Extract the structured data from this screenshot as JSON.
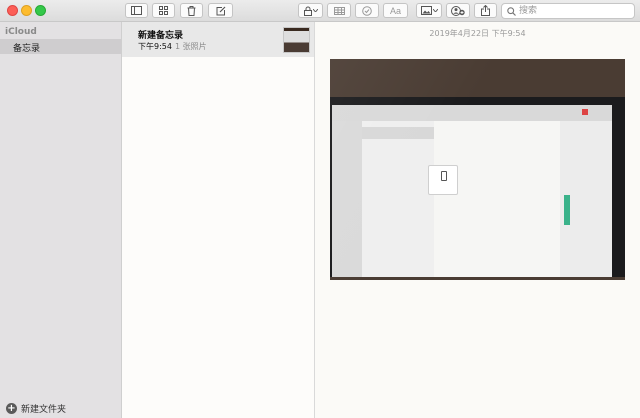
{
  "toolbar": {
    "buttons": [
      {
        "name": "sidebar-toggle",
        "icon": "sidebar-icon"
      },
      {
        "name": "gallery-view",
        "icon": "grid-icon"
      },
      {
        "name": "delete",
        "icon": "trash-icon"
      },
      {
        "name": "compose",
        "icon": "compose-icon"
      },
      {
        "name": "lock",
        "icon": "lock-icon"
      },
      {
        "name": "table",
        "icon": "table-icon"
      },
      {
        "name": "checklist",
        "icon": "checkmark-circle-icon"
      },
      {
        "name": "format",
        "icon": "format-icon"
      },
      {
        "name": "media",
        "icon": "photo-icon"
      },
      {
        "name": "collaborate",
        "icon": "add-people-icon"
      },
      {
        "name": "share",
        "icon": "share-icon"
      }
    ],
    "search": {
      "placeholder": "搜索",
      "value": ""
    },
    "format_label": "Aa"
  },
  "sidebar": {
    "account": "iCloud",
    "folders": [
      {
        "label": "备忘录",
        "selected": true
      }
    ],
    "new_folder_label": "新建文件夹"
  },
  "notelist": {
    "notes": [
      {
        "title": "新建备忘录",
        "time": "下午9:54",
        "attachments": "1 张照片",
        "selected": true
      }
    ]
  },
  "editor": {
    "date": "2019年4月22日 下午9:54"
  },
  "colors": {
    "sidebar_bg": "#e3e1e3",
    "selection_bg": "#cfcdcf",
    "note_selected_bg": "#e8e8e8",
    "editor_bg": "#fbfaf7"
  }
}
